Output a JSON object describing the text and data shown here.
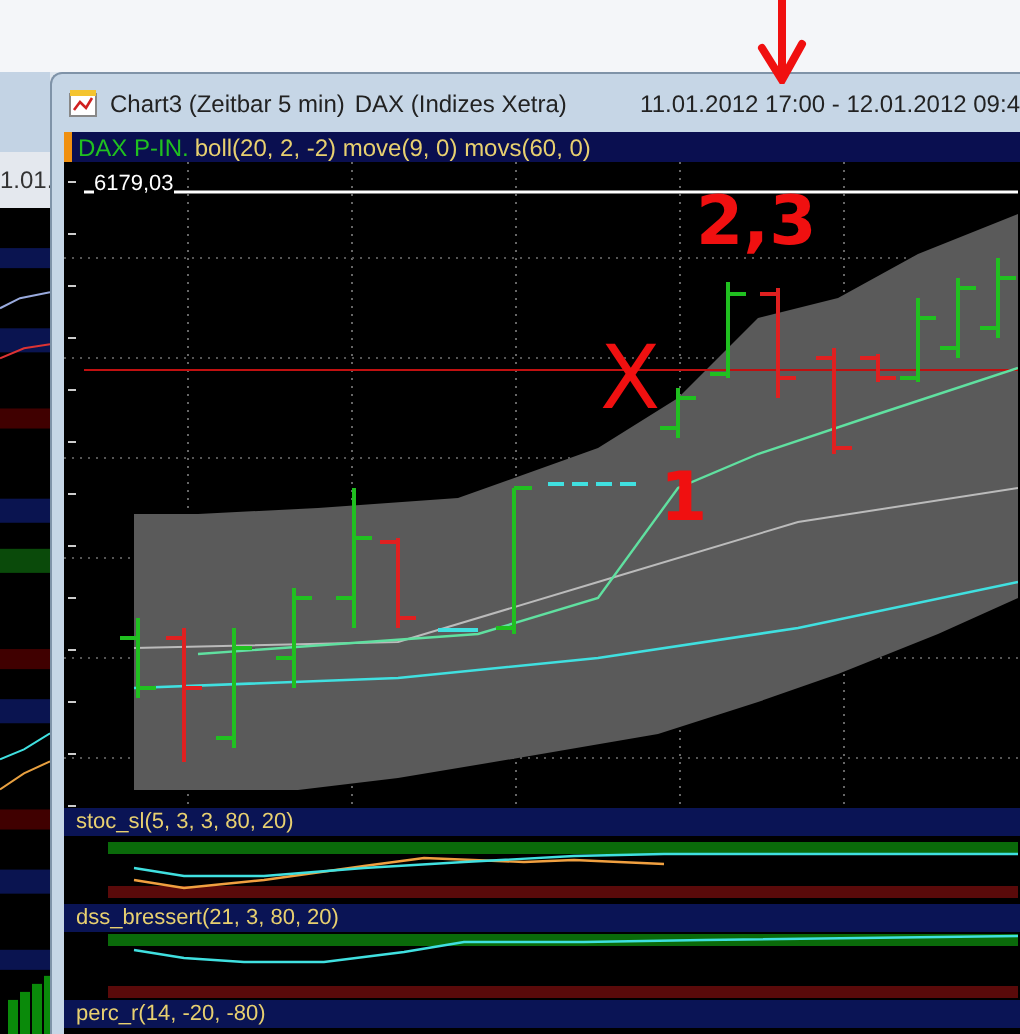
{
  "background_window": {
    "title_fragment": "1.01."
  },
  "window": {
    "title": "Chart3 (Zeitbar 5 min)",
    "instrument": "DAX (Indizes Xetra)",
    "date_range": "11.01.2012 17:00 - 12.01.2012 09:4"
  },
  "price_panel": {
    "symbol": "DAX P-IN.",
    "indicators": "boll(20, 2, -2) move(9, 0) movs(60, 0)",
    "price_label": "6179,03"
  },
  "indicator_panels": [
    {
      "label": "stoc_sl(5, 3, 3, 80, 20)",
      "kind": "double"
    },
    {
      "label": "dss_bressert(21, 3, 80, 20)",
      "kind": "single"
    },
    {
      "label": "perc_r(14, -20, -80)",
      "kind": "header"
    }
  ],
  "annotations": [
    {
      "text": "2,3",
      "kind": "digits"
    },
    {
      "text": "X",
      "kind": "cross"
    },
    {
      "text": "1",
      "kind": "digits"
    }
  ]
}
